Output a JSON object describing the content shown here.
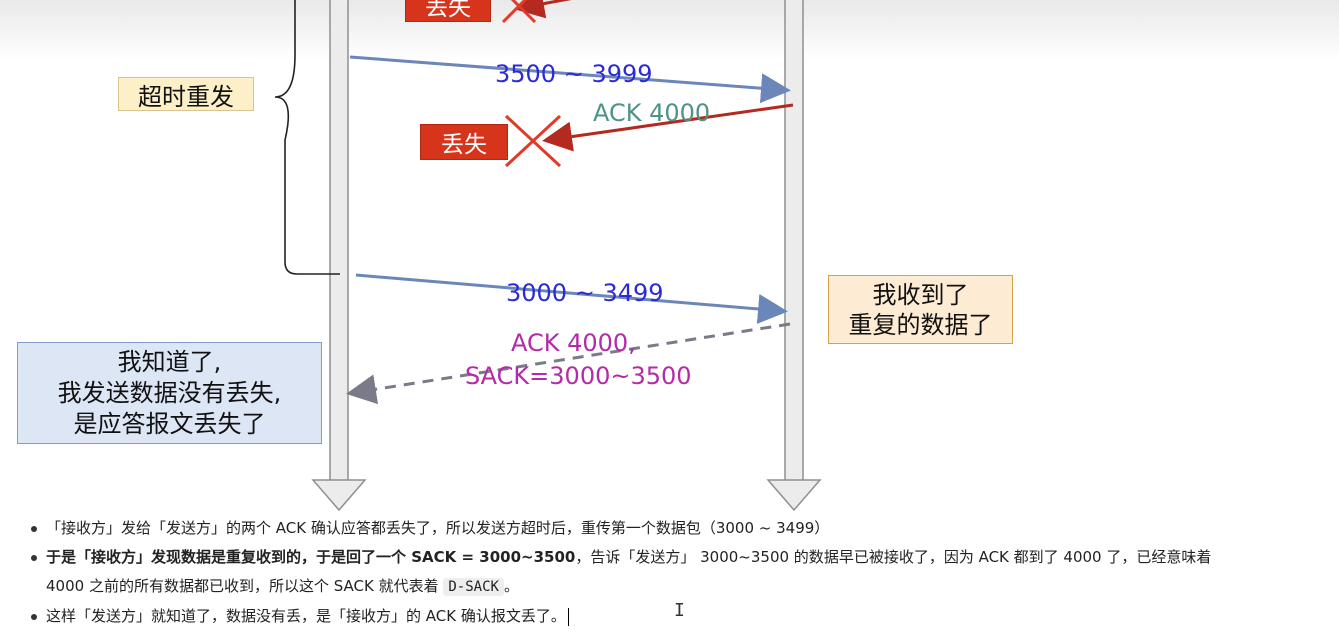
{
  "diagram": {
    "top_lost_label": "丢失",
    "lost_label": "丢失",
    "timeout_label": "超时重发",
    "seg_retrans_label": "3500 ~ 3999",
    "ack_label": "ACK 4000",
    "seg_label": "3000 ~ 3499",
    "dsack_line1": "ACK 4000,",
    "dsack_line2": "SACK=3000~3500",
    "receiver_note": [
      "我收到了",
      "重复的数据了"
    ],
    "sender_note": [
      "我知道了,",
      "我发送数据没有丢失,",
      "是应答报文丢失了"
    ]
  },
  "bullets": {
    "b1": "「接收方」发给「发送方」的两个 ACK 确认应答都丢失了，所以发送方超时后，重传第一个数据包（3000 ~ 3499）",
    "b2_bold": "于是「接收方」发现数据是重复收到的，于是回了一个 SACK = 3000~3500",
    "b2_rest": "，告诉「发送方」 3000~3500 的数据早已被接收了，因为 ACK 都到了 4000 了，已经意味着",
    "b2_line2": "4000 之前的所有数据都已收到，所以这个 SACK 就代表着 ",
    "b2_code": "D-SACK",
    "b2_end": "。",
    "b3": "这样「发送方」就知道了，数据没有丢，是「接收方」的 ACK 确认报文丢了。"
  },
  "colors": {
    "seg_text": "#2b2bd6",
    "ack_text": "#4f9384",
    "dsack_text": "#b52aa8",
    "lost_bg": "#d6341b",
    "cross": "#e23a2a",
    "ack_arrow": "#b42a20",
    "seg_arrow": "#6b86b8",
    "timeout_bg": "#fdf0c8",
    "sender_note_bg": "#dce6f4",
    "receiver_note_bg": "#fdebd3"
  }
}
